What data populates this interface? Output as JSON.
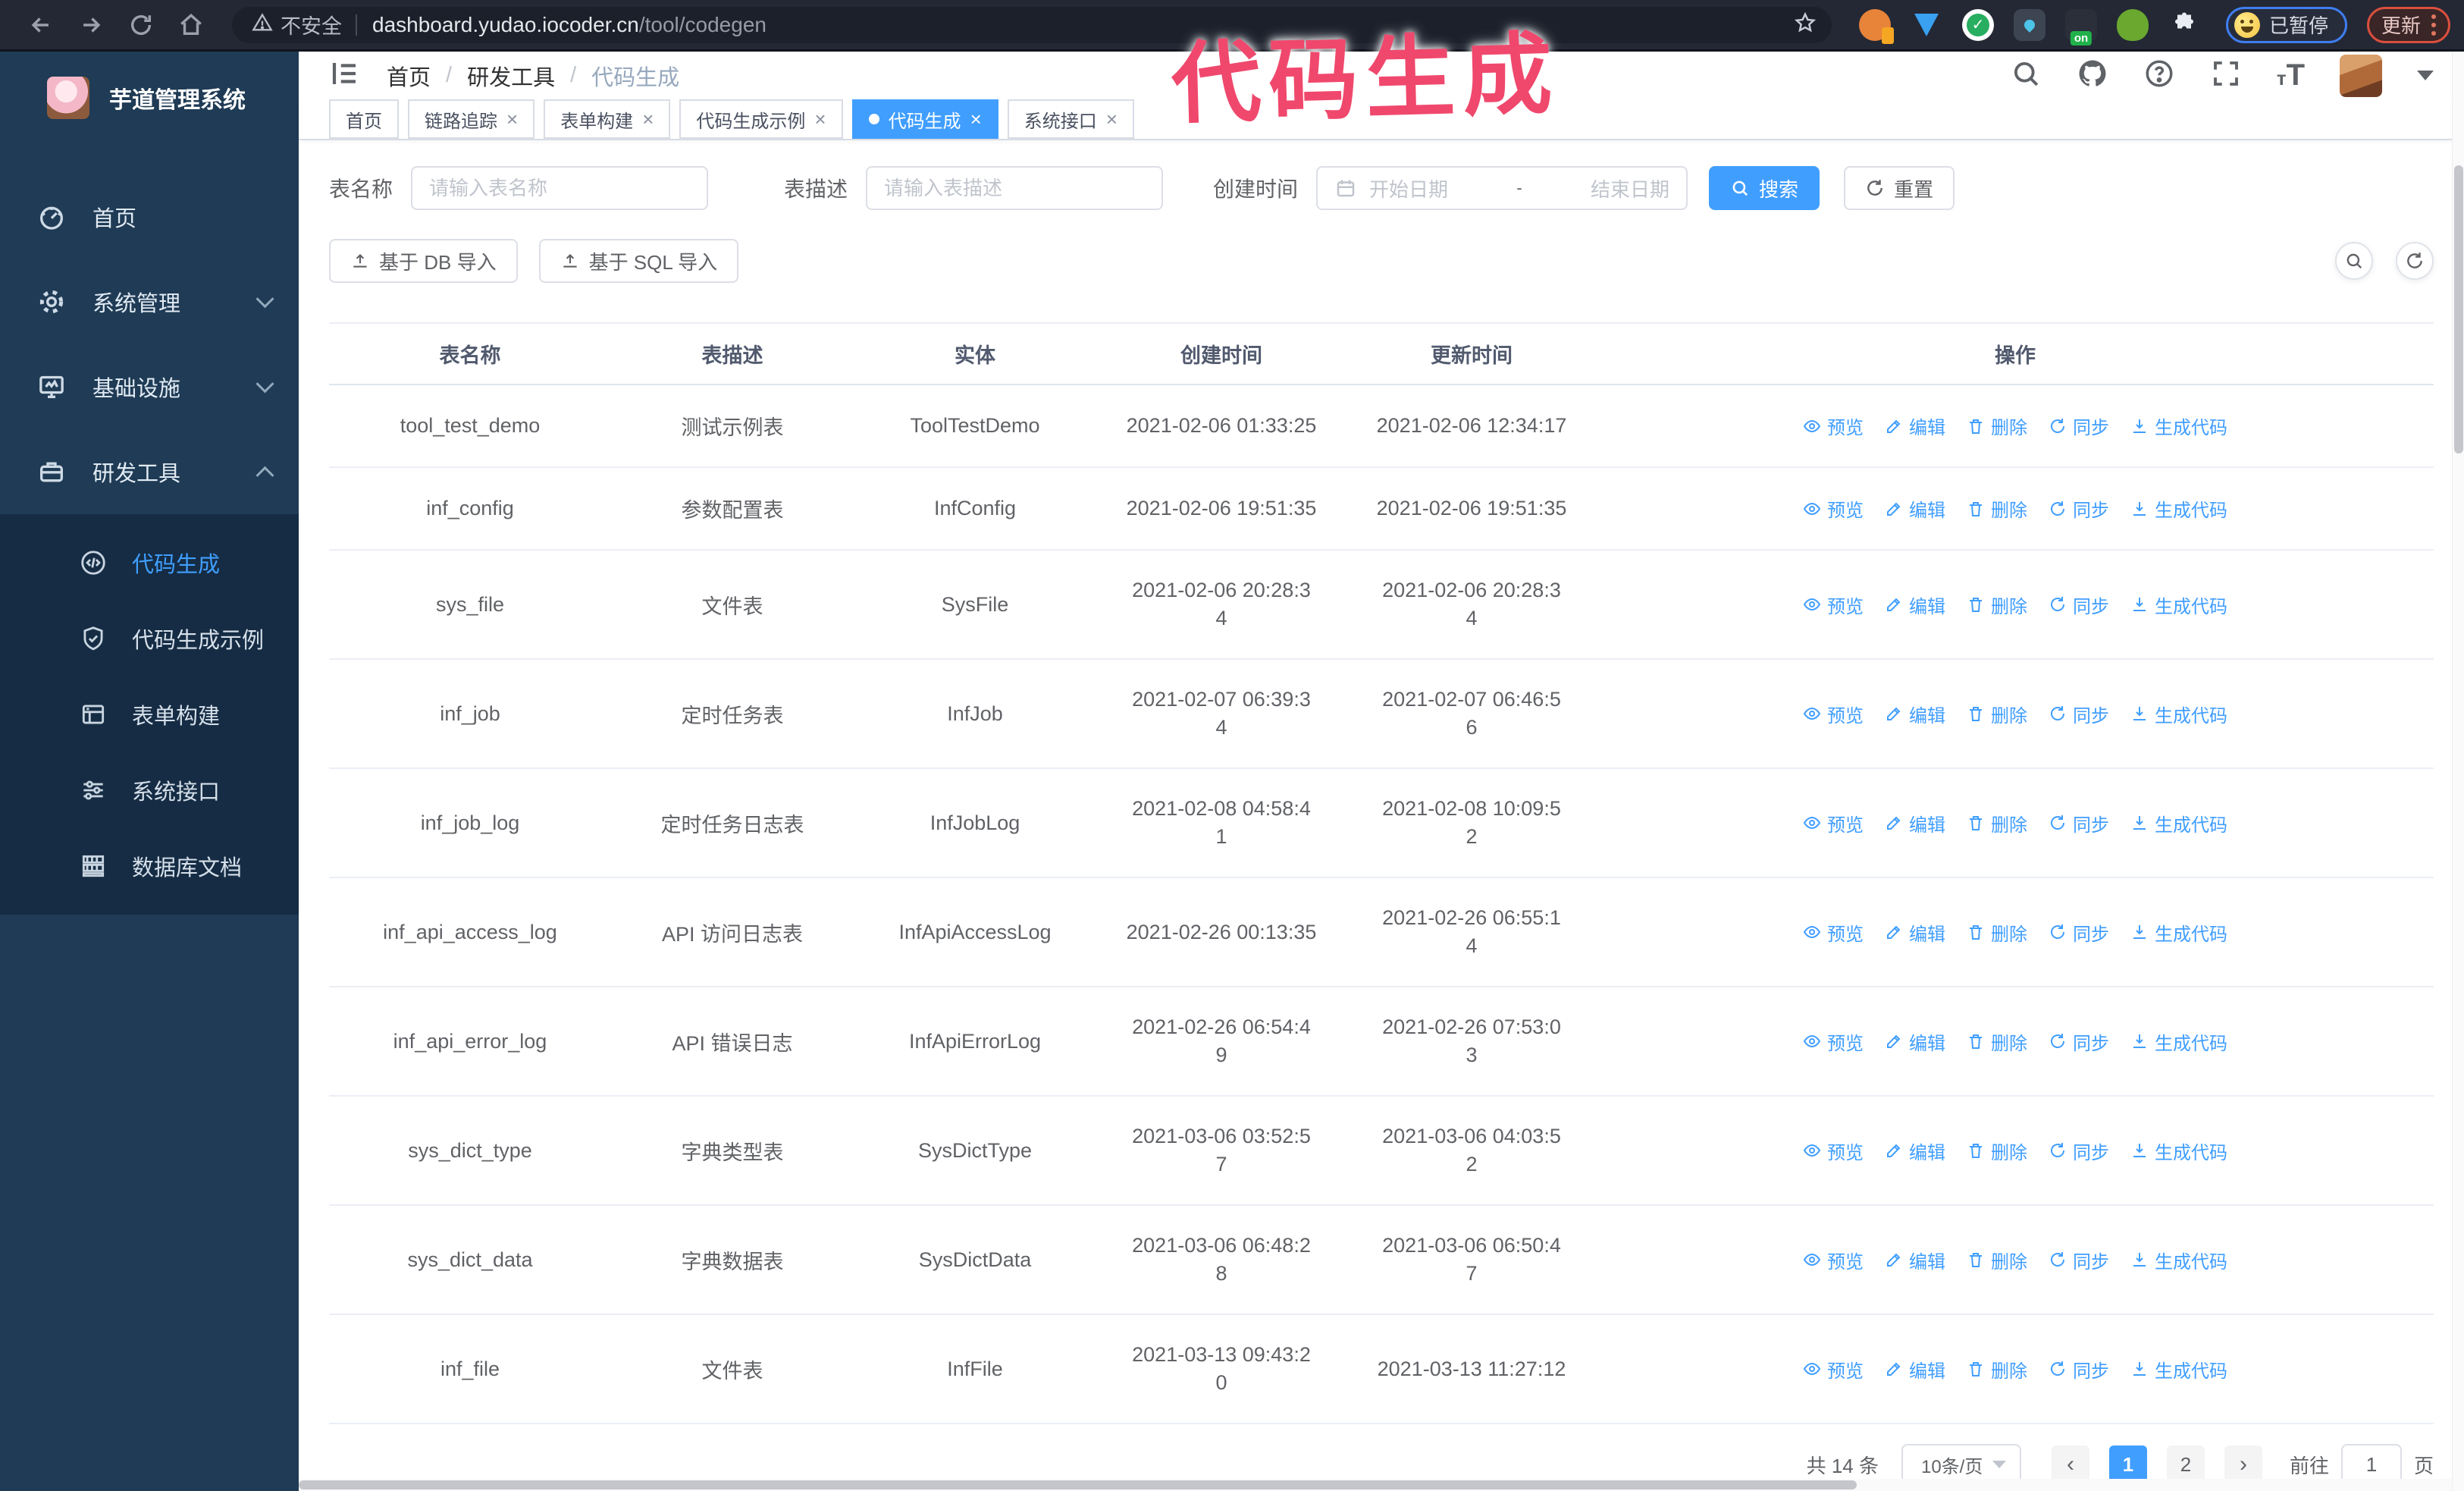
{
  "browser": {
    "security_label": "不安全",
    "url_host": "dashboard.yudao.iocoder.cn",
    "url_path": "/tool/codegen",
    "paused_button": "已暂停",
    "update_button": "更新",
    "extension_on_badge": "on"
  },
  "annotation": {
    "text": "代码生成",
    "color": "#f0486d"
  },
  "sidebar": {
    "title": "芋道管理系统",
    "items": [
      {
        "label": "首页",
        "icon": "dashboard-icon"
      },
      {
        "label": "系统管理",
        "icon": "gear-icon",
        "state": "collapsed"
      },
      {
        "label": "基础设施",
        "icon": "monitor-icon",
        "state": "collapsed"
      },
      {
        "label": "研发工具",
        "icon": "toolbox-icon",
        "state": "expanded"
      }
    ],
    "submenu": [
      {
        "label": "代码生成",
        "icon": "code-icon",
        "active": true
      },
      {
        "label": "代码生成示例",
        "icon": "shield-check-icon",
        "active": false
      },
      {
        "label": "表单构建",
        "icon": "form-icon",
        "active": false
      },
      {
        "label": "系统接口",
        "icon": "sliders-icon",
        "active": false
      },
      {
        "label": "数据库文档",
        "icon": "database-icon",
        "active": false
      }
    ]
  },
  "header": {
    "breadcrumb": [
      "首页",
      "研发工具",
      "代码生成"
    ]
  },
  "tabs": [
    {
      "label": "首页",
      "closable": false,
      "active": false
    },
    {
      "label": "链路追踪",
      "closable": true,
      "active": false
    },
    {
      "label": "表单构建",
      "closable": true,
      "active": false
    },
    {
      "label": "代码生成示例",
      "closable": true,
      "active": false
    },
    {
      "label": "代码生成",
      "closable": true,
      "active": true
    },
    {
      "label": "系统接口",
      "closable": true,
      "active": false
    }
  ],
  "filters": {
    "table_name_label": "表名称",
    "table_name_placeholder": "请输入表名称",
    "table_desc_label": "表描述",
    "table_desc_placeholder": "请输入表描述",
    "create_time_label": "创建时间",
    "date_start_placeholder": "开始日期",
    "date_separator": "-",
    "date_end_placeholder": "结束日期",
    "search_label": "搜索",
    "reset_label": "重置"
  },
  "toolbar": {
    "import_db_label": "基于 DB 导入",
    "import_sql_label": "基于 SQL 导入"
  },
  "table": {
    "columns": [
      "表名称",
      "表描述",
      "实体",
      "创建时间",
      "更新时间",
      "操作"
    ],
    "actions": [
      {
        "label": "预览",
        "icon": "eye-icon",
        "name": "preview"
      },
      {
        "label": "编辑",
        "icon": "edit-icon",
        "name": "edit"
      },
      {
        "label": "删除",
        "icon": "delete-icon",
        "name": "delete"
      },
      {
        "label": "同步",
        "icon": "sync-icon",
        "name": "sync"
      },
      {
        "label": "生成代码",
        "icon": "download-icon",
        "name": "generate-code"
      }
    ],
    "rows": [
      {
        "name": "tool_test_demo",
        "desc": "测试示例表",
        "entity": "ToolTestDemo",
        "create_time": "2021-02-06 01:33:25",
        "update_time": "2021-02-06 12:34:17"
      },
      {
        "name": "inf_config",
        "desc": "参数配置表",
        "entity": "InfConfig",
        "create_time": "2021-02-06 19:51:35",
        "update_time": "2021-02-06 19:51:35"
      },
      {
        "name": "sys_file",
        "desc": "文件表",
        "entity": "SysFile",
        "create_time": "2021-02-06 20:28:3\n4",
        "update_time": "2021-02-06 20:28:3\n4"
      },
      {
        "name": "inf_job",
        "desc": "定时任务表",
        "entity": "InfJob",
        "create_time": "2021-02-07 06:39:3\n4",
        "update_time": "2021-02-07 06:46:5\n6"
      },
      {
        "name": "inf_job_log",
        "desc": "定时任务日志表",
        "entity": "InfJobLog",
        "create_time": "2021-02-08 04:58:4\n1",
        "update_time": "2021-02-08 10:09:5\n2"
      },
      {
        "name": "inf_api_access_log",
        "desc": "API 访问日志表",
        "entity": "InfApiAccessLog",
        "create_time": "2021-02-26 00:13:35",
        "update_time": "2021-02-26 06:55:1\n4"
      },
      {
        "name": "inf_api_error_log",
        "desc": "API 错误日志",
        "entity": "InfApiErrorLog",
        "create_time": "2021-02-26 06:54:4\n9",
        "update_time": "2021-02-26 07:53:0\n3"
      },
      {
        "name": "sys_dict_type",
        "desc": "字典类型表",
        "entity": "SysDictType",
        "create_time": "2021-03-06 03:52:5\n7",
        "update_time": "2021-03-06 04:03:5\n2"
      },
      {
        "name": "sys_dict_data",
        "desc": "字典数据表",
        "entity": "SysDictData",
        "create_time": "2021-03-06 06:48:2\n8",
        "update_time": "2021-03-06 06:50:4\n7"
      },
      {
        "name": "inf_file",
        "desc": "文件表",
        "entity": "InfFile",
        "create_time": "2021-03-13 09:43:2\n0",
        "update_time": "2021-03-13 11:27:12"
      }
    ]
  },
  "pagination": {
    "total": "共 14 条",
    "page_size": "10条/页",
    "prev": "‹",
    "pages": [
      "1",
      "2"
    ],
    "active_page": "1",
    "next": "›",
    "goto_label": "前往",
    "goto_value": "1",
    "page_label": "页"
  },
  "colors": {
    "accent": "#409eff",
    "sidebar_bg": "#1f3b55",
    "submenu_bg": "#152c44",
    "browser_bar_bg": "#232834",
    "annotation_pink": "#f0486d",
    "active_tab_bg": "#409eff"
  }
}
